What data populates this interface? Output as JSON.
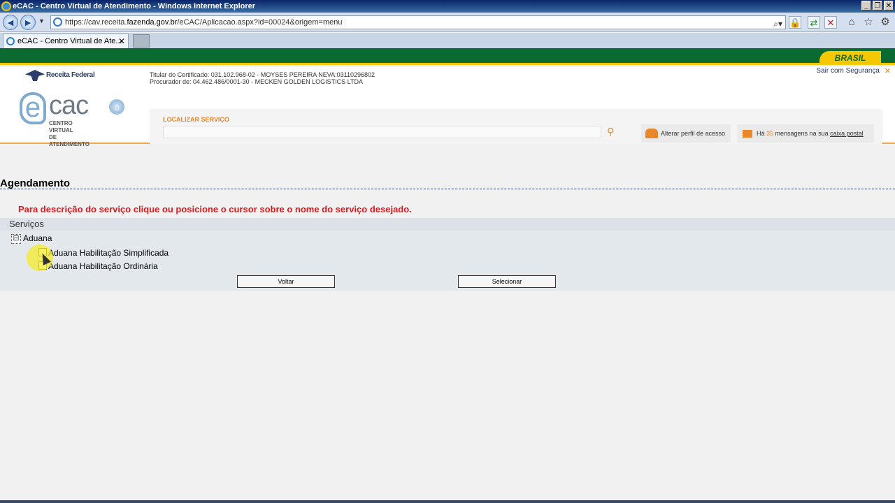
{
  "window": {
    "title": "eCAC - Centro Virtual de Atendimento - Windows Internet Explorer"
  },
  "address": {
    "prefix": "https://cav.receita.",
    "domain": "fazenda.gov.br",
    "suffix": "/eCAC/Aplicacao.aspx?id=00024&origem=menu"
  },
  "tab": {
    "title": "eCAC - Centro Virtual de Ate..."
  },
  "header": {
    "brasil": "BRASIL",
    "sair": "Sair com Segurança",
    "receita": "Receita Federal",
    "ecac_sub_1": "CENTRO VIRTUAL",
    "ecac_sub_2": "DE ATENDIMENTO",
    "cert_line1": "Titular do Certificado: 031.102.968-02 - MOYSES PEREIRA NEVA:03110296802",
    "cert_line2": "Procurador de: 04.462.486/0001-30 - MECKEN GOLDEN LOGISTICS LTDA",
    "search_label": "LOCALIZAR SERVIÇO",
    "search_value": "",
    "perfil": "Alterar perfil de acesso",
    "msg_prefix": "Há ",
    "msg_count": "35",
    "msg_middle": " mensagens na sua ",
    "msg_link": "caixa postal"
  },
  "content": {
    "title": "Agendamento",
    "instruction": "Para descrição do serviço clique ou posicione o cursor sobre o nome do serviço desejado.",
    "services_header": "Serviços",
    "tree_toggle": "⊟",
    "group": "Aduana",
    "items": [
      "Aduana Habilitação Simplificada",
      "Aduana Habilitação Ordinária"
    ],
    "btn_back": "Voltar",
    "btn_select": "Selecionar"
  },
  "colors": {
    "green": "#0b6a2f",
    "yellow": "#f5c800",
    "orange": "#e8882a",
    "red": "#e0191d"
  }
}
